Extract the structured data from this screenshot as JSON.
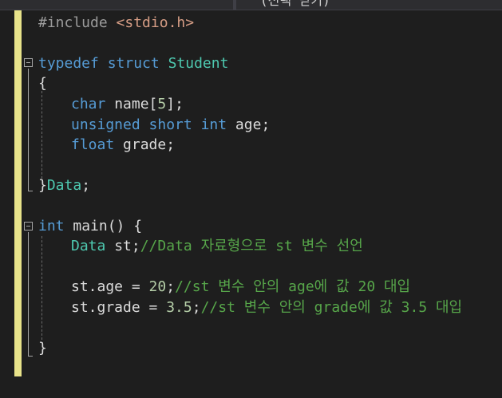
{
  "window": {
    "tab_label": "(선택 닫기)"
  },
  "colors": {
    "background": "#1e1e1e",
    "margin_indicator": "#e8e38a",
    "keyword": "#569cd6",
    "type": "#4ec9b0",
    "string": "#d69d85",
    "preprocessor": "#9b9b9b",
    "comment": "#57a64a",
    "number": "#b5cea8",
    "identifier": "#dcdcdc"
  },
  "code": {
    "l1": {
      "directive": "#include",
      "header": "<stdio.h>"
    },
    "l3": {
      "kw1": "typedef",
      "kw2": "struct",
      "name": "Student"
    },
    "l4": {
      "brace": "{"
    },
    "l5": {
      "type": "char",
      "rest": " name[",
      "num": "5",
      "end": "];"
    },
    "l6": {
      "kw1": "unsigned",
      "kw2": "short",
      "kw3": "int",
      "rest": " age;"
    },
    "l7": {
      "type": "float",
      "rest": " grade;"
    },
    "l9": {
      "brace": "}",
      "name": "Data",
      "end": ";"
    },
    "l11": {
      "type": "int",
      "rest": " main() {"
    },
    "l12": {
      "type": "Data",
      "rest": " st;",
      "comment": "//Data 자료형으로 st 변수 선언"
    },
    "l14": {
      "rest": "st.age = ",
      "num": "20",
      "end": ";",
      "comment": "//st 변수 안의 age에 값 20 대입"
    },
    "l15": {
      "rest": "st.grade = ",
      "num": "3.5",
      "end": ";",
      "comment": "//st 변수 안의 grade에 값 3.5 대입"
    },
    "l17": {
      "brace": "}"
    }
  }
}
